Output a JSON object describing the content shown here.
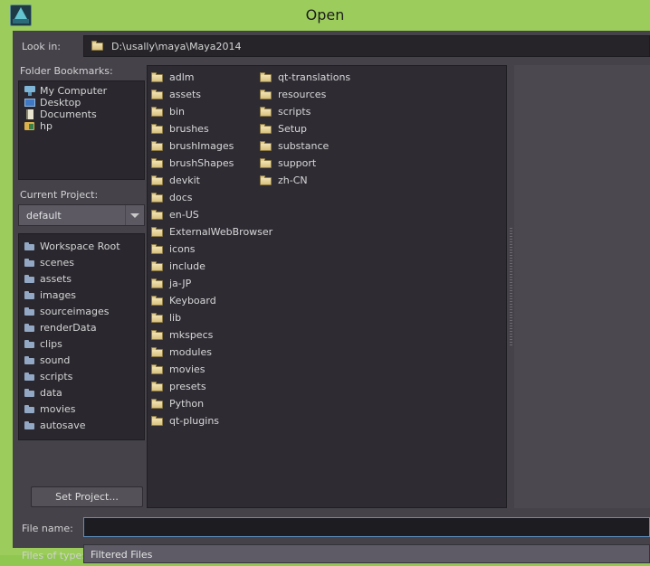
{
  "window": {
    "title": "Open",
    "app_icon": "maya-app-icon",
    "accent_green": "#9ccd5c",
    "dialog_bg": "#45424a"
  },
  "lookin": {
    "label": "Look in:",
    "path": "D:\\usally\\maya\\Maya2014",
    "icon": "folder-icon"
  },
  "bookmarks": {
    "label": "Folder Bookmarks:",
    "items": [
      {
        "label": "My Computer",
        "icon": "computer-icon"
      },
      {
        "label": "Desktop",
        "icon": "desktop-icon"
      },
      {
        "label": "Documents",
        "icon": "documents-icon"
      },
      {
        "label": "hp",
        "icon": "folder-icon"
      }
    ]
  },
  "project": {
    "label": "Current Project:",
    "combo_value": "default",
    "combo_arrow": "chevron-down-icon",
    "items": [
      {
        "label": "Workspace Root",
        "icon": "folder-icon"
      },
      {
        "label": "scenes",
        "icon": "folder-icon"
      },
      {
        "label": "assets",
        "icon": "folder-icon"
      },
      {
        "label": "images",
        "icon": "folder-icon"
      },
      {
        "label": "sourceimages",
        "icon": "folder-icon"
      },
      {
        "label": "renderData",
        "icon": "folder-icon"
      },
      {
        "label": "clips",
        "icon": "folder-icon"
      },
      {
        "label": "sound",
        "icon": "folder-icon"
      },
      {
        "label": "scripts",
        "icon": "folder-icon"
      },
      {
        "label": "data",
        "icon": "folder-icon"
      },
      {
        "label": "movies",
        "icon": "folder-icon"
      },
      {
        "label": "autosave",
        "icon": "folder-icon"
      }
    ],
    "set_project_label": "Set Project..."
  },
  "files": {
    "column1": [
      {
        "name": "adlm",
        "icon": "folder-icon"
      },
      {
        "name": "assets",
        "icon": "folder-icon"
      },
      {
        "name": "bin",
        "icon": "folder-icon"
      },
      {
        "name": "brushes",
        "icon": "folder-icon"
      },
      {
        "name": "brushImages",
        "icon": "folder-icon"
      },
      {
        "name": "brushShapes",
        "icon": "folder-icon"
      },
      {
        "name": "devkit",
        "icon": "folder-icon"
      },
      {
        "name": "docs",
        "icon": "folder-icon"
      },
      {
        "name": "en-US",
        "icon": "folder-icon"
      },
      {
        "name": "ExternalWebBrowser",
        "icon": "folder-icon"
      },
      {
        "name": "icons",
        "icon": "folder-icon"
      },
      {
        "name": "include",
        "icon": "folder-icon"
      },
      {
        "name": "ja-JP",
        "icon": "folder-icon"
      },
      {
        "name": "Keyboard",
        "icon": "folder-icon"
      },
      {
        "name": "lib",
        "icon": "folder-icon"
      },
      {
        "name": "mkspecs",
        "icon": "folder-icon"
      },
      {
        "name": "modules",
        "icon": "folder-icon"
      },
      {
        "name": "movies",
        "icon": "folder-icon"
      },
      {
        "name": "presets",
        "icon": "folder-icon"
      },
      {
        "name": "Python",
        "icon": "folder-icon"
      },
      {
        "name": "qt-plugins",
        "icon": "folder-icon"
      }
    ],
    "column2": [
      {
        "name": "qt-translations",
        "icon": "folder-icon"
      },
      {
        "name": "resources",
        "icon": "folder-icon"
      },
      {
        "name": "scripts",
        "icon": "folder-icon"
      },
      {
        "name": "Setup",
        "icon": "folder-icon"
      },
      {
        "name": "substance",
        "icon": "folder-icon"
      },
      {
        "name": "support",
        "icon": "folder-icon"
      },
      {
        "name": "zh-CN",
        "icon": "folder-icon"
      }
    ]
  },
  "filename": {
    "label": "File name:",
    "value": "",
    "placeholder": ""
  },
  "filetype": {
    "label": "Files of type:",
    "value": "Filtered Files"
  }
}
